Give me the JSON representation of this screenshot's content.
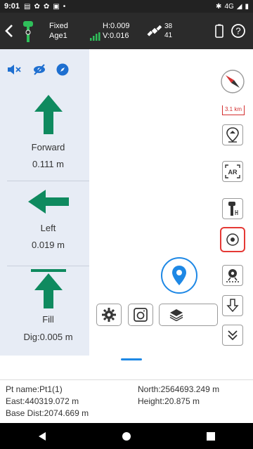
{
  "status_bar": {
    "time": "9:01",
    "network": "4G"
  },
  "header": {
    "back_icon": "chevron-left-icon",
    "fix_status": "Fixed",
    "age": "Age1",
    "h_precision": "H:0.009",
    "v_precision": "V:0.016",
    "sats_used": "38",
    "sats_visible": "41"
  },
  "left_panel": {
    "tools": [
      "mute-icon",
      "hide-icon",
      "compass-icon"
    ],
    "sections": [
      {
        "direction": "Forward",
        "value": "0.111 m"
      },
      {
        "direction": "Left",
        "value": "0.019 m"
      },
      {
        "direction": "Fill",
        "value": "Dig:0.005 m"
      }
    ]
  },
  "map": {
    "scale_label": "3.1 km"
  },
  "right_toolbar": [
    "point-target-icon",
    "ar-icon",
    "antenna-icon",
    "target-icon",
    "stakeout-point-icon",
    "download-arrow-icon",
    "chevron-double-down-icon"
  ],
  "bottom_toolbar": [
    "settings-icon",
    "camera-icon",
    "layers-icon"
  ],
  "info": {
    "pt_name": "Pt name:Pt1(1)",
    "north": "North:2564693.249 m",
    "east": "East:440319.072 m",
    "height": "Height:20.875 m",
    "base_dist": "Base Dist:2074.669 m"
  },
  "colors": {
    "arrow_green": "#0f8a5f",
    "accent_blue": "#1e88e5",
    "panel_bg": "#e7ecf5",
    "header_bg": "#2b2b2b",
    "selected_border": "#e53935"
  }
}
